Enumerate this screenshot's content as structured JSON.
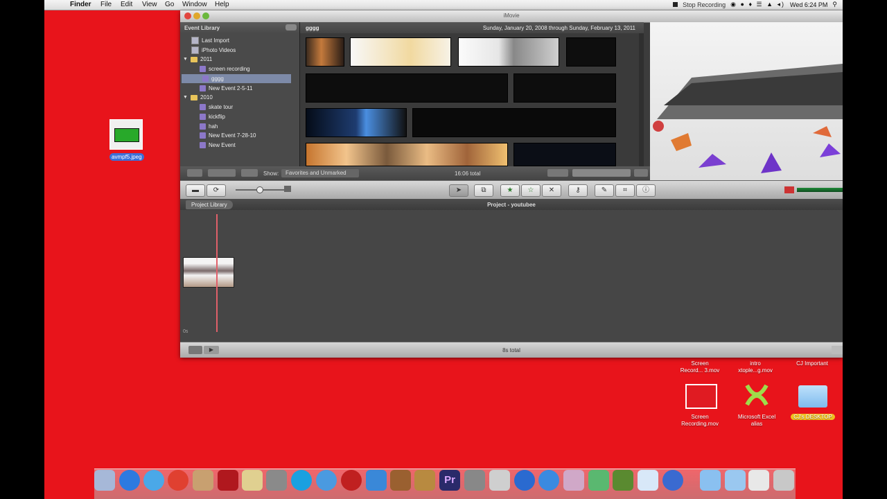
{
  "menubar": {
    "app": "Finder",
    "menus": [
      "File",
      "Edit",
      "View",
      "Go",
      "Window",
      "Help"
    ],
    "stop_recording": "Stop Recording",
    "clock": "Wed 6:24 PM"
  },
  "window": {
    "title": "iMovie"
  },
  "event_library": {
    "header": "Event Library",
    "items": [
      {
        "label": "Last Import"
      },
      {
        "label": "iPhoto Videos"
      },
      {
        "label": "2011"
      },
      {
        "label": "screen recording"
      },
      {
        "label": "gggg"
      },
      {
        "label": "New Event 2-5-11"
      },
      {
        "label": "2010"
      },
      {
        "label": "skate tour"
      },
      {
        "label": "kickflip"
      },
      {
        "label": "hah"
      },
      {
        "label": "New Event 7-28-10"
      },
      {
        "label": "New Event"
      }
    ]
  },
  "browser": {
    "event_name": "gggg",
    "date_range": "Sunday, January 20, 2008 through Sunday, February 13, 2011",
    "show_label": "Show:",
    "show_value": "Favorites and Unmarked",
    "total": "16:06 total"
  },
  "project": {
    "library_button": "Project Library",
    "title": "Project - youtubee",
    "total": "8s total",
    "time_start": "0s"
  },
  "desktop": {
    "selected_file": "avmpf5.jpeg",
    "icons": [
      {
        "top": "Screen\nRecord... 3.mov",
        "bottom": "Screen\nRecording.mov"
      },
      {
        "top": "intro\nxtople...g.mov",
        "bottom": "Microsoft Excel\nalias"
      },
      {
        "top": "CJ Important",
        "bottom": "CJ's DESKTOP"
      }
    ]
  },
  "colors": {
    "desktop": "#e8141b",
    "selection": "#7d8aa8",
    "playhead": "#e0606a"
  }
}
